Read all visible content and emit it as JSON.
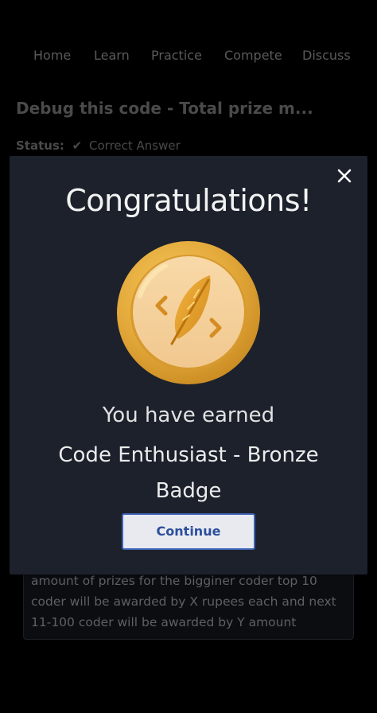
{
  "nav": {
    "items": [
      "Home",
      "Learn",
      "Practice",
      "Compete",
      "Discuss"
    ]
  },
  "problem": {
    "title": "Debug this code - Total prize m...",
    "status_label": "Status:",
    "status_value": "Correct Answer",
    "description": "amount of prizes for the bigginer coder top 10 coder will be awarded by X rupees each and next 11-100 coder will be awarded by Y amount"
  },
  "modal": {
    "title": "Congratulations!",
    "earned_text": "You have earned",
    "badge_name": "Code Enthusiast - Bronze Badge",
    "continue_label": "Continue",
    "close_icon": "close-icon",
    "badge_icon": "feather-code-badge-icon"
  },
  "colors": {
    "modal_bg": "#1c212c",
    "button_border": "#3f63b7",
    "badge_gold": "#e2a83c"
  }
}
